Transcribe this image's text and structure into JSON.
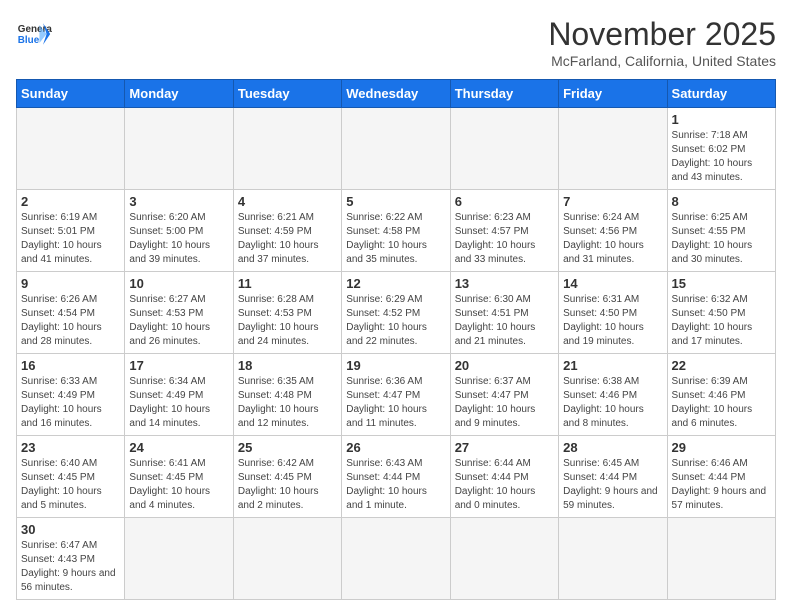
{
  "header": {
    "logo_general": "General",
    "logo_blue": "Blue",
    "month_title": "November 2025",
    "location": "McFarland, California, United States"
  },
  "days_of_week": [
    "Sunday",
    "Monday",
    "Tuesday",
    "Wednesday",
    "Thursday",
    "Friday",
    "Saturday"
  ],
  "weeks": [
    [
      {
        "day": "",
        "info": ""
      },
      {
        "day": "",
        "info": ""
      },
      {
        "day": "",
        "info": ""
      },
      {
        "day": "",
        "info": ""
      },
      {
        "day": "",
        "info": ""
      },
      {
        "day": "",
        "info": ""
      },
      {
        "day": "1",
        "info": "Sunrise: 7:18 AM\nSunset: 6:02 PM\nDaylight: 10 hours and 43 minutes."
      }
    ],
    [
      {
        "day": "2",
        "info": "Sunrise: 6:19 AM\nSunset: 5:01 PM\nDaylight: 10 hours and 41 minutes."
      },
      {
        "day": "3",
        "info": "Sunrise: 6:20 AM\nSunset: 5:00 PM\nDaylight: 10 hours and 39 minutes."
      },
      {
        "day": "4",
        "info": "Sunrise: 6:21 AM\nSunset: 4:59 PM\nDaylight: 10 hours and 37 minutes."
      },
      {
        "day": "5",
        "info": "Sunrise: 6:22 AM\nSunset: 4:58 PM\nDaylight: 10 hours and 35 minutes."
      },
      {
        "day": "6",
        "info": "Sunrise: 6:23 AM\nSunset: 4:57 PM\nDaylight: 10 hours and 33 minutes."
      },
      {
        "day": "7",
        "info": "Sunrise: 6:24 AM\nSunset: 4:56 PM\nDaylight: 10 hours and 31 minutes."
      },
      {
        "day": "8",
        "info": "Sunrise: 6:25 AM\nSunset: 4:55 PM\nDaylight: 10 hours and 30 minutes."
      }
    ],
    [
      {
        "day": "9",
        "info": "Sunrise: 6:26 AM\nSunset: 4:54 PM\nDaylight: 10 hours and 28 minutes."
      },
      {
        "day": "10",
        "info": "Sunrise: 6:27 AM\nSunset: 4:53 PM\nDaylight: 10 hours and 26 minutes."
      },
      {
        "day": "11",
        "info": "Sunrise: 6:28 AM\nSunset: 4:53 PM\nDaylight: 10 hours and 24 minutes."
      },
      {
        "day": "12",
        "info": "Sunrise: 6:29 AM\nSunset: 4:52 PM\nDaylight: 10 hours and 22 minutes."
      },
      {
        "day": "13",
        "info": "Sunrise: 6:30 AM\nSunset: 4:51 PM\nDaylight: 10 hours and 21 minutes."
      },
      {
        "day": "14",
        "info": "Sunrise: 6:31 AM\nSunset: 4:50 PM\nDaylight: 10 hours and 19 minutes."
      },
      {
        "day": "15",
        "info": "Sunrise: 6:32 AM\nSunset: 4:50 PM\nDaylight: 10 hours and 17 minutes."
      }
    ],
    [
      {
        "day": "16",
        "info": "Sunrise: 6:33 AM\nSunset: 4:49 PM\nDaylight: 10 hours and 16 minutes."
      },
      {
        "day": "17",
        "info": "Sunrise: 6:34 AM\nSunset: 4:49 PM\nDaylight: 10 hours and 14 minutes."
      },
      {
        "day": "18",
        "info": "Sunrise: 6:35 AM\nSunset: 4:48 PM\nDaylight: 10 hours and 12 minutes."
      },
      {
        "day": "19",
        "info": "Sunrise: 6:36 AM\nSunset: 4:47 PM\nDaylight: 10 hours and 11 minutes."
      },
      {
        "day": "20",
        "info": "Sunrise: 6:37 AM\nSunset: 4:47 PM\nDaylight: 10 hours and 9 minutes."
      },
      {
        "day": "21",
        "info": "Sunrise: 6:38 AM\nSunset: 4:46 PM\nDaylight: 10 hours and 8 minutes."
      },
      {
        "day": "22",
        "info": "Sunrise: 6:39 AM\nSunset: 4:46 PM\nDaylight: 10 hours and 6 minutes."
      }
    ],
    [
      {
        "day": "23",
        "info": "Sunrise: 6:40 AM\nSunset: 4:45 PM\nDaylight: 10 hours and 5 minutes."
      },
      {
        "day": "24",
        "info": "Sunrise: 6:41 AM\nSunset: 4:45 PM\nDaylight: 10 hours and 4 minutes."
      },
      {
        "day": "25",
        "info": "Sunrise: 6:42 AM\nSunset: 4:45 PM\nDaylight: 10 hours and 2 minutes."
      },
      {
        "day": "26",
        "info": "Sunrise: 6:43 AM\nSunset: 4:44 PM\nDaylight: 10 hours and 1 minute."
      },
      {
        "day": "27",
        "info": "Sunrise: 6:44 AM\nSunset: 4:44 PM\nDaylight: 10 hours and 0 minutes."
      },
      {
        "day": "28",
        "info": "Sunrise: 6:45 AM\nSunset: 4:44 PM\nDaylight: 9 hours and 59 minutes."
      },
      {
        "day": "29",
        "info": "Sunrise: 6:46 AM\nSunset: 4:44 PM\nDaylight: 9 hours and 57 minutes."
      }
    ],
    [
      {
        "day": "30",
        "info": "Sunrise: 6:47 AM\nSunset: 4:43 PM\nDaylight: 9 hours and 56 minutes."
      },
      {
        "day": "",
        "info": ""
      },
      {
        "day": "",
        "info": ""
      },
      {
        "day": "",
        "info": ""
      },
      {
        "day": "",
        "info": ""
      },
      {
        "day": "",
        "info": ""
      },
      {
        "day": "",
        "info": ""
      }
    ]
  ]
}
